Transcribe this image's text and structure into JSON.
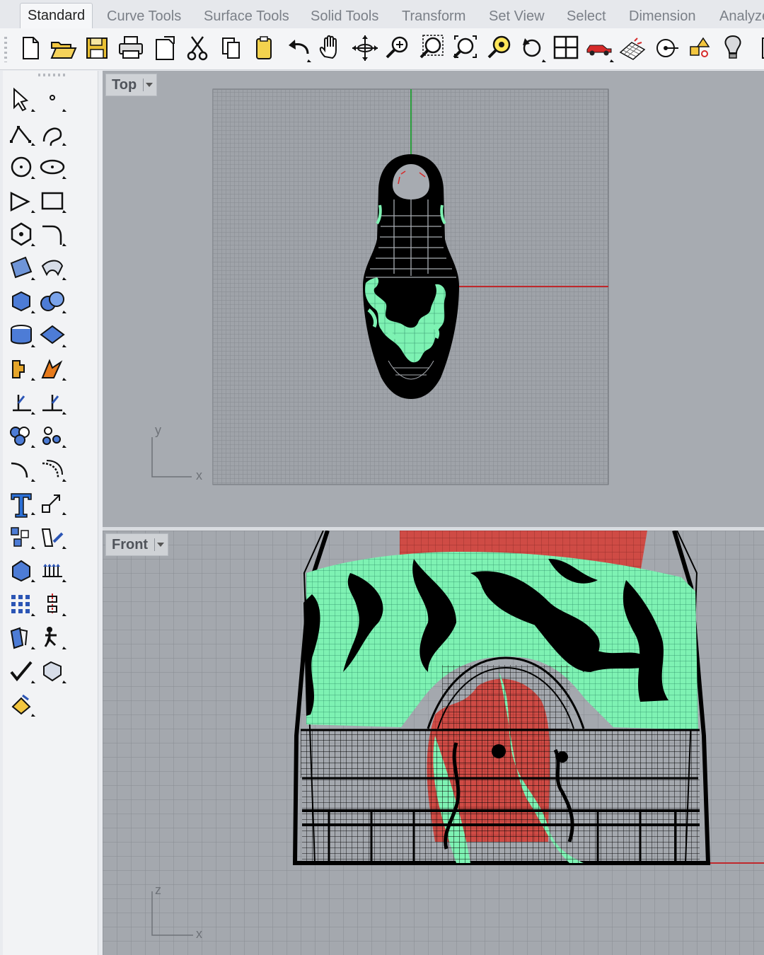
{
  "tabs": [
    {
      "label": "Standard",
      "active": true
    },
    {
      "label": "Curve Tools"
    },
    {
      "label": "Surface Tools"
    },
    {
      "label": "Solid Tools"
    },
    {
      "label": "Transform"
    },
    {
      "label": "Set View"
    },
    {
      "label": "Select"
    },
    {
      "label": "Dimension"
    },
    {
      "label": "Analyze"
    }
  ],
  "toolbar_icons": [
    "new-file-icon",
    "open-folder-icon",
    "save-icon",
    "print-icon",
    "import-icon",
    "cut-icon",
    "copy-icon",
    "paste-icon",
    "undo-icon",
    "pan-hand-icon",
    "rotate-view-icon",
    "zoom-icon",
    "zoom-window-icon",
    "zoom-extents-icon",
    "zoom-selected-icon",
    "undo-view-icon",
    "four-viewports-icon",
    "car-display-icon",
    "render-grid-icon",
    "point-icon",
    "properties-icon",
    "light-bulb-icon"
  ],
  "left_tools": [
    "select-arrow-icon",
    "point-icon",
    "polyline-icon",
    "curve-icon",
    "circle-icon",
    "ellipse-icon",
    "arc-icon",
    "rectangle-icon",
    "polygon-icon",
    "fillet-icon",
    "surface-corner-icon",
    "sweep-icon",
    "box-icon",
    "boolean-icon",
    "cylinder-icon",
    "mesh-icon",
    "puzzle-icon",
    "explode-icon",
    "split-icon",
    "trim-icon",
    "group-icon",
    "points-cloud-icon",
    "curve-arc-icon",
    "offset-icon",
    "text-icon",
    "scale-icon",
    "array-icon",
    "edit-icon",
    "solid-edit-icon",
    "extrude-icon",
    "grid-array-icon",
    "mirror-icon",
    "layers-icon",
    "analyze-icon",
    "check-icon",
    "shape-icon",
    "paint-icon"
  ],
  "viewports": {
    "top": {
      "label": "Top",
      "axis_x": "x",
      "axis_y": "y"
    },
    "front": {
      "label": "Front",
      "axis_x": "x",
      "axis_y": "z"
    }
  },
  "colors": {
    "grid_line": "#8a8e94",
    "green_axis": "#2a9d3c",
    "red_axis": "#c0282c",
    "mint": "#7ef2b3",
    "red_fill": "#cf4b45"
  }
}
